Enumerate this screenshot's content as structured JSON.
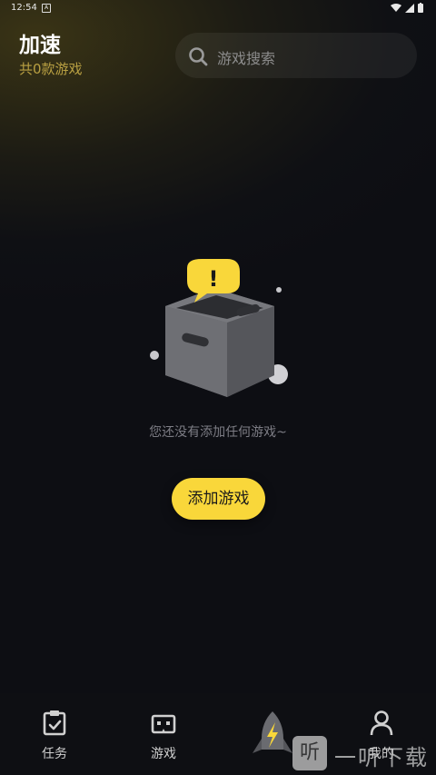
{
  "status_bar": {
    "time": "12:54",
    "badge": "A"
  },
  "header": {
    "title": "加速",
    "subtitle": "共0款游戏"
  },
  "search": {
    "placeholder": "游戏搜索"
  },
  "empty_state": {
    "message": "您还没有添加任何游戏~",
    "badge": "!",
    "button_label": "添加游戏"
  },
  "nav": {
    "items": [
      {
        "label": "任务",
        "icon": "task-clipboard-icon"
      },
      {
        "label": "游戏",
        "icon": "gamepad-icon"
      },
      {
        "label": "",
        "icon": "rocket-boost-icon"
      },
      {
        "label": "我的",
        "icon": "profile-person-icon"
      }
    ]
  },
  "watermark": {
    "text": "一听下载",
    "glyph": "听"
  },
  "colors": {
    "accent": "#f9d73a",
    "subtitle": "#b9a042",
    "background": "#0d0e13"
  }
}
